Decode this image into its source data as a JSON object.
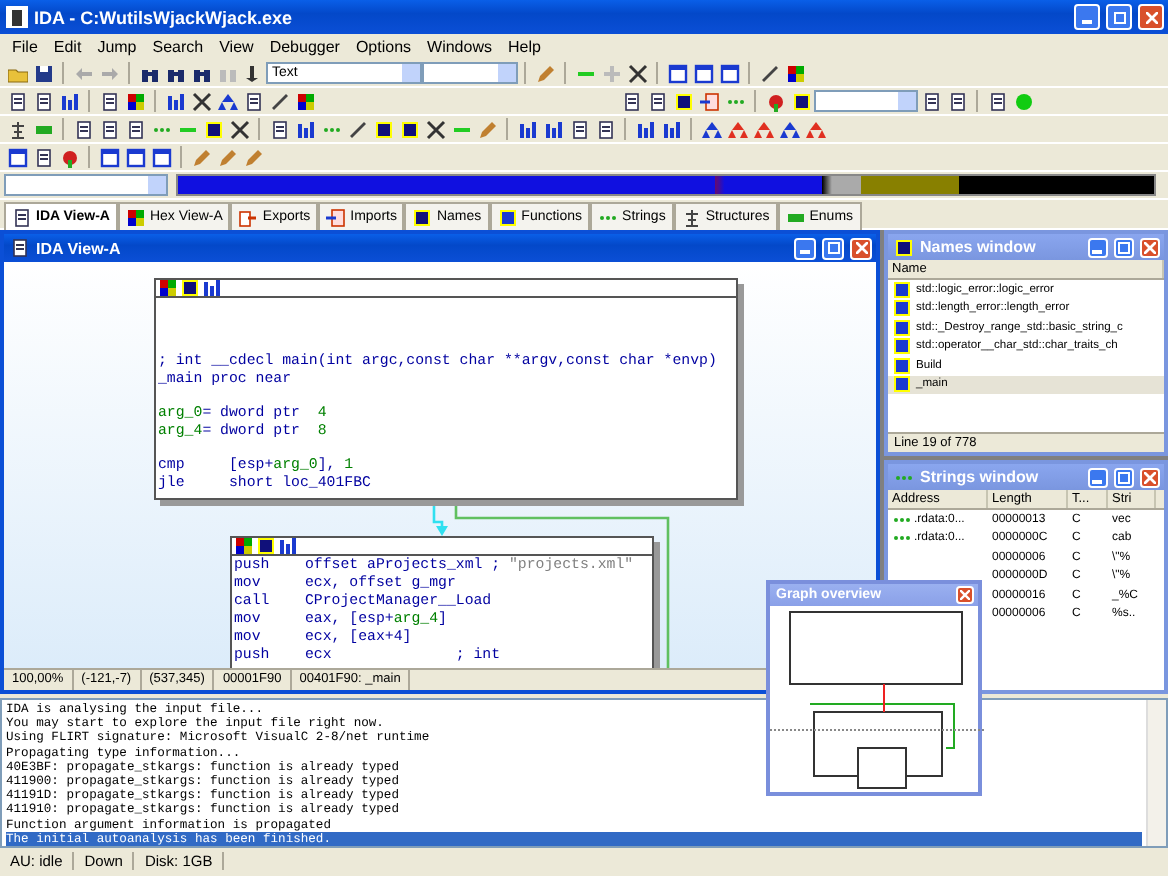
{
  "window": {
    "title": "IDA - C:WutilsWjackWjack.exe"
  },
  "menu": [
    "File",
    "Edit",
    "Jump",
    "Search",
    "View",
    "Debugger",
    "Options",
    "Windows",
    "Help"
  ],
  "toolbar": {
    "view_combo": "Text"
  },
  "tabs": [
    {
      "label": "IDA View-A",
      "selected": true
    },
    {
      "label": "Hex View-A",
      "selected": false
    },
    {
      "label": "Exports",
      "selected": false
    },
    {
      "label": "Imports",
      "selected": false
    },
    {
      "label": "Names",
      "selected": false
    },
    {
      "label": "Functions",
      "selected": false
    },
    {
      "label": "Strings",
      "selected": false
    },
    {
      "label": "Structures",
      "selected": false
    },
    {
      "label": "Enums",
      "selected": false
    }
  ],
  "ida_view": {
    "title": "IDA View-A",
    "blocks": [
      {
        "groups": [
          [
            [
              {
                "text": "; int __cdecl main(int argc,const char **argv,const char *envp)",
                "kind": "code"
              }
            ],
            [
              {
                "text": "_main proc near",
                "kind": "code"
              }
            ]
          ],
          [
            [
              {
                "text": "arg_0",
                "kind": "arg"
              },
              {
                "text": "= dword ptr  ",
                "kind": "code"
              },
              {
                "text": "4",
                "kind": "arg"
              }
            ],
            [
              {
                "text": "arg_4",
                "kind": "arg"
              },
              {
                "text": "= dword ptr  ",
                "kind": "code"
              },
              {
                "text": "8",
                "kind": "arg"
              }
            ]
          ],
          [
            [
              {
                "text": "cmp     [esp+",
                "kind": "code"
              },
              {
                "text": "arg_0",
                "kind": "arg"
              },
              {
                "text": "], ",
                "kind": "code"
              },
              {
                "text": "1",
                "kind": "arg"
              }
            ],
            [
              {
                "text": "jle     short loc_401FBC",
                "kind": "code"
              }
            ]
          ]
        ]
      },
      {
        "groups": [
          [
            [
              {
                "text": "push    offset aProjects_xml ; ",
                "kind": "code"
              },
              {
                "text": "\"projects.xml\"",
                "kind": "comment"
              }
            ],
            [
              {
                "text": "mov     ecx, offset g_mgr",
                "kind": "code"
              }
            ],
            [
              {
                "text": "call    CProjectManager__Load",
                "kind": "code"
              }
            ],
            [
              {
                "text": "mov     eax, [esp+",
                "kind": "code"
              },
              {
                "text": "arg_4",
                "kind": "arg"
              },
              {
                "text": "]",
                "kind": "code"
              }
            ],
            [
              {
                "text": "mov     ecx, [eax+4]",
                "kind": "code"
              }
            ],
            [
              {
                "text": "push    ecx              ; int",
                "kind": "code"
              }
            ]
          ]
        ]
      }
    ],
    "status": [
      "100,00%",
      "(-121,-7)",
      "(537,345)",
      "00001F90",
      "00401F90: _main"
    ]
  },
  "names_window": {
    "title": "Names window",
    "column": "Name",
    "rows": [
      {
        "name": "std::logic_error::logic_error",
        "selected": false
      },
      {
        "name": "std::length_error::length_error",
        "selected": false
      },
      {
        "name": "std::_Destroy_range_std::basic_string_c",
        "selected": false
      },
      {
        "name": "std::operator__char_std::char_traits_ch",
        "selected": false
      },
      {
        "name": "Build",
        "selected": false
      },
      {
        "name": "_main",
        "selected": true
      }
    ],
    "footer": "Line 19 of 778"
  },
  "strings_window": {
    "title": "Strings window",
    "columns": [
      "Address",
      "Length",
      "T...",
      "Stri"
    ],
    "rows": [
      {
        "address": ".rdata:0...",
        "length": "00000013",
        "type": "C",
        "string": "vec"
      },
      {
        "address": ".rdata:0...",
        "length": "0000000C",
        "type": "C",
        "string": "cab"
      },
      {
        "length": "00000006",
        "type": "C",
        "string": "\\\"%"
      },
      {
        "length": "0000000D",
        "type": "C",
        "string": "\\\"%"
      },
      {
        "length": "00000016",
        "type": "C",
        "string": "_%C"
      },
      {
        "length": "00000006",
        "type": "C",
        "string": "%s.."
      }
    ]
  },
  "graph_overview": {
    "title": "Graph overview"
  },
  "output": {
    "lines": [
      {
        "text": "IDA is analysing the input file...",
        "selected": false
      },
      {
        "text": "You may start to explore the input file right now.",
        "selected": false
      },
      {
        "text": "Using FLIRT signature: Microsoft VisualC 2-8/net runtime",
        "selected": false
      },
      {
        "text": "Propagating type information...",
        "selected": false
      },
      {
        "text": "40E3BF: propagate_stkargs: function is already typed",
        "selected": false
      },
      {
        "text": "411900: propagate_stkargs: function is already typed",
        "selected": false
      },
      {
        "text": "41191D: propagate_stkargs: function is already typed",
        "selected": false
      },
      {
        "text": "411910: propagate_stkargs: function is already typed",
        "selected": false
      },
      {
        "text": "Function argument information is propagated",
        "selected": false
      },
      {
        "text": "The initial autoanalysis has been finished.",
        "selected": true
      }
    ]
  },
  "status_bar": [
    "AU:  idle",
    "Down",
    "Disk: 1GB"
  ]
}
